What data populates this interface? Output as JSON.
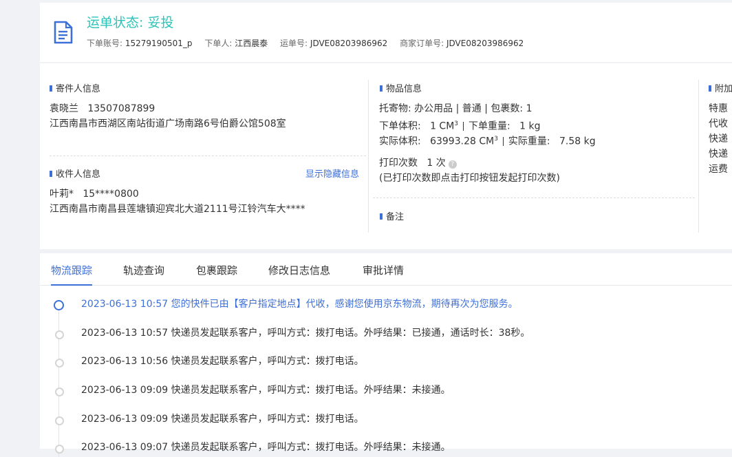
{
  "header": {
    "status_label": "运单状态:",
    "status_value": "妥投",
    "account_key": "下单账号:",
    "account_value": "15279190501_p",
    "orderer_key": "下单人:",
    "orderer_value": "江西晨泰",
    "waybill_key": "运单号:",
    "waybill_value": "JDVE08203986962",
    "merchant_key": "商家订单号:",
    "merchant_value": "JDVE08203986962"
  },
  "sender": {
    "title": "寄件人信息",
    "name": "袁晓兰",
    "phone": "13507087899",
    "address": "江西南昌市西湖区南站街道广场南路6号伯爵公馆508室"
  },
  "receiver": {
    "title": "收件人信息",
    "show_hidden": "显示隐藏信息",
    "name": "叶莉*",
    "phone": "15****0800",
    "address": "江西南昌市南昌县莲塘镇迎宾北大道2111号江铃汽车大****"
  },
  "goods": {
    "title": "物品信息",
    "line1": "托寄物:  办公用品 | 普通  |  包裹数:  1",
    "order_volume_key": "下单体积:",
    "order_volume_value": "1 CM",
    "order_weight_key": "下单重量:",
    "order_weight_value": "1 kg",
    "actual_volume_key": "实际体积:",
    "actual_volume_value": "63993.28 CM",
    "actual_weight_key": "实际重量:",
    "actual_weight_value": "7.58 kg",
    "unit_exp": "3",
    "print_key": "打印次数",
    "print_value": "1 次",
    "help_glyph": "?",
    "print_note": "(已打印次数即点击打印按钮发起打印次数)"
  },
  "remark": {
    "title": "备注"
  },
  "extra": {
    "title": "附加",
    "lines": [
      "特惠",
      "代收",
      "快递",
      "快递",
      "运费"
    ]
  },
  "tabs": [
    "物流跟踪",
    "轨迹查询",
    "包裹跟踪",
    "修改日志信息",
    "审批详情"
  ],
  "timeline": [
    "2023-06-13 10:57 您的快件已由【客户指定地点】代收，感谢您使用京东物流，期待再次为您服务。",
    "2023-06-13 10:57 快递员发起联系客户，呼叫方式：拨打电话。外呼结果：已接通，通话时长：38秒。",
    "2023-06-13 10:56 快递员发起联系客户，呼叫方式：拨打电话。",
    "2023-06-13 09:09 快递员发起联系客户，呼叫方式：拨打电话。外呼结果：未接通。",
    "2023-06-13 09:09 快递员发起联系客户，呼叫方式：拨打电话。",
    "2023-06-13 09:07 快递员发起联系客户，呼叫方式：拨打电话。外呼结果：未接通。"
  ],
  "colors": {
    "accent": "#3d6fd8",
    "status": "#2ec3b8"
  }
}
